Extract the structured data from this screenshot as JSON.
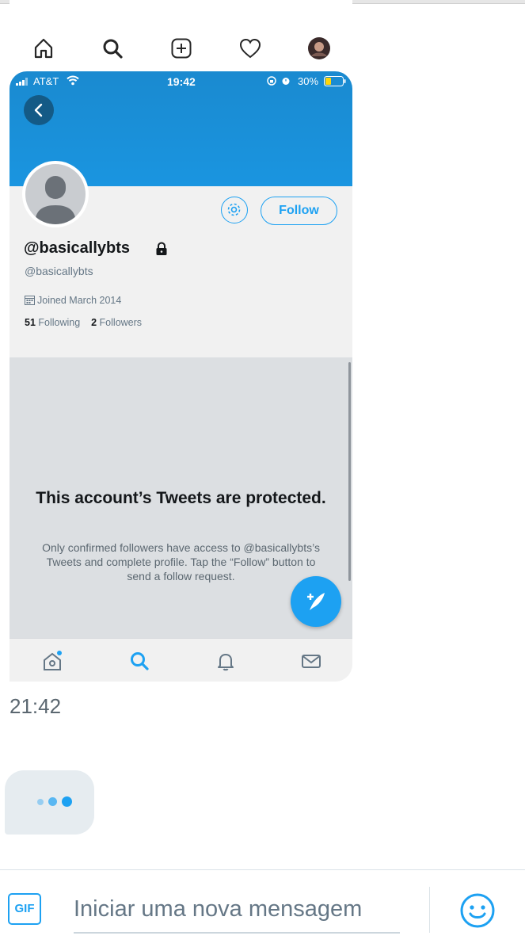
{
  "instagram_nav": {
    "icons": [
      "home-icon",
      "search-icon",
      "add-post-icon",
      "heart-icon",
      "profile-avatar"
    ]
  },
  "phone_status": {
    "carrier": "AT&T",
    "time": "19:42",
    "battery": "30%"
  },
  "profile": {
    "display_name": "@basicallybts",
    "handle": "@basicallybts",
    "joined": "Joined March 2014",
    "following_count": "51",
    "following_label": "Following",
    "followers_count": "2",
    "followers_label": "Followers",
    "follow_button": "Follow",
    "protected_title": "This account’s Tweets are protected.",
    "protected_desc": "Only confirmed followers have access to @basicallybts’s Tweets and complete profile. Tap the “Follow” button to send a follow request."
  },
  "twitter_nav": {
    "icons": [
      "home-icon",
      "search-icon",
      "notifications-icon",
      "messages-icon"
    ]
  },
  "chat": {
    "timestamp": "21:42"
  },
  "composer": {
    "gif_label": "GIF",
    "placeholder": "Iniciar uma nova mensagem"
  },
  "colors": {
    "accent": "#1da1f2",
    "banner": "#1a8ad0"
  }
}
